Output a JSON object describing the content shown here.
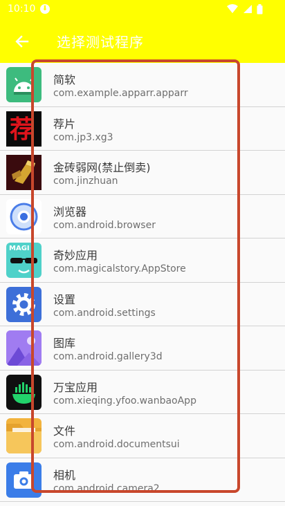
{
  "status_bar": {
    "time": "10:10",
    "notification_icon": "download-icon",
    "icons": [
      "wifi-icon",
      "signal-icon",
      "battery-icon"
    ]
  },
  "header": {
    "title": "选择测试程序",
    "back_icon": "arrow-left-icon",
    "background": "#ffff00"
  },
  "apps": [
    {
      "name": "简软",
      "package": "com.example.apparr.apparr",
      "icon": "android-robot-icon"
    },
    {
      "name": "荐片",
      "package": "com.jp3.xg3",
      "icon": "jianpian-icon",
      "icon_text": "荐"
    },
    {
      "name": "金砖弱网(禁止倒卖)",
      "package": "com.jinzhuan",
      "icon": "gold-brick-icon"
    },
    {
      "name": "浏览器",
      "package": "com.android.browser",
      "icon": "browser-icon"
    },
    {
      "name": "奇妙应用",
      "package": "com.magicalstory.AppStore",
      "icon": "magic-app-icon",
      "icon_text": "MAGI"
    },
    {
      "name": "设置",
      "package": "com.android.settings",
      "icon": "settings-gear-icon"
    },
    {
      "name": "图库",
      "package": "com.android.gallery3d",
      "icon": "gallery-icon"
    },
    {
      "name": "万宝应用",
      "package": "com.xieqing.yfoo.wanbaoApp",
      "icon": "wanbao-icon"
    },
    {
      "name": "文件",
      "package": "com.android.documentsui",
      "icon": "folder-icon"
    },
    {
      "name": "相机",
      "package": "com.android.camera2",
      "icon": "camera-icon"
    }
  ],
  "colors": {
    "accent": "#ffff00",
    "highlight_frame": "#c8472c",
    "divider": "#d2d2d2"
  }
}
